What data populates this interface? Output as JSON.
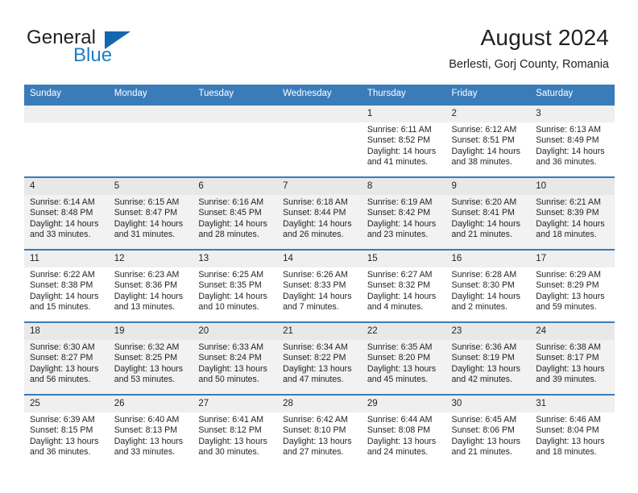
{
  "brand": {
    "name_part1": "General",
    "name_part2": "Blue",
    "accent_color": "#1567ad",
    "logo_icon": "triangle-flag-icon"
  },
  "header": {
    "title": "August 2024",
    "location": "Berlesti, Gorj County, Romania"
  },
  "theme": {
    "header_row_bg": "#3a7cba",
    "row_border": "#3a7cba",
    "daynum_bg": "#efefef",
    "shaded_row_bg": "#f2f2f2",
    "text_color": "#231f20"
  },
  "weekday_headers": [
    "Sunday",
    "Monday",
    "Tuesday",
    "Wednesday",
    "Thursday",
    "Friday",
    "Saturday"
  ],
  "weeks": [
    [
      {
        "day": "",
        "empty": true,
        "sunrise": "",
        "sunset": "",
        "daylight1": "",
        "daylight2": ""
      },
      {
        "day": "",
        "empty": true,
        "sunrise": "",
        "sunset": "",
        "daylight1": "",
        "daylight2": ""
      },
      {
        "day": "",
        "empty": true,
        "sunrise": "",
        "sunset": "",
        "daylight1": "",
        "daylight2": ""
      },
      {
        "day": "",
        "empty": true,
        "sunrise": "",
        "sunset": "",
        "daylight1": "",
        "daylight2": ""
      },
      {
        "day": "1",
        "empty": false,
        "sunrise": "Sunrise: 6:11 AM",
        "sunset": "Sunset: 8:52 PM",
        "daylight1": "Daylight: 14 hours",
        "daylight2": "and 41 minutes."
      },
      {
        "day": "2",
        "empty": false,
        "sunrise": "Sunrise: 6:12 AM",
        "sunset": "Sunset: 8:51 PM",
        "daylight1": "Daylight: 14 hours",
        "daylight2": "and 38 minutes."
      },
      {
        "day": "3",
        "empty": false,
        "sunrise": "Sunrise: 6:13 AM",
        "sunset": "Sunset: 8:49 PM",
        "daylight1": "Daylight: 14 hours",
        "daylight2": "and 36 minutes."
      }
    ],
    [
      {
        "day": "4",
        "empty": false,
        "sunrise": "Sunrise: 6:14 AM",
        "sunset": "Sunset: 8:48 PM",
        "daylight1": "Daylight: 14 hours",
        "daylight2": "and 33 minutes."
      },
      {
        "day": "5",
        "empty": false,
        "sunrise": "Sunrise: 6:15 AM",
        "sunset": "Sunset: 8:47 PM",
        "daylight1": "Daylight: 14 hours",
        "daylight2": "and 31 minutes."
      },
      {
        "day": "6",
        "empty": false,
        "sunrise": "Sunrise: 6:16 AM",
        "sunset": "Sunset: 8:45 PM",
        "daylight1": "Daylight: 14 hours",
        "daylight2": "and 28 minutes."
      },
      {
        "day": "7",
        "empty": false,
        "sunrise": "Sunrise: 6:18 AM",
        "sunset": "Sunset: 8:44 PM",
        "daylight1": "Daylight: 14 hours",
        "daylight2": "and 26 minutes."
      },
      {
        "day": "8",
        "empty": false,
        "sunrise": "Sunrise: 6:19 AM",
        "sunset": "Sunset: 8:42 PM",
        "daylight1": "Daylight: 14 hours",
        "daylight2": "and 23 minutes."
      },
      {
        "day": "9",
        "empty": false,
        "sunrise": "Sunrise: 6:20 AM",
        "sunset": "Sunset: 8:41 PM",
        "daylight1": "Daylight: 14 hours",
        "daylight2": "and 21 minutes."
      },
      {
        "day": "10",
        "empty": false,
        "sunrise": "Sunrise: 6:21 AM",
        "sunset": "Sunset: 8:39 PM",
        "daylight1": "Daylight: 14 hours",
        "daylight2": "and 18 minutes."
      }
    ],
    [
      {
        "day": "11",
        "empty": false,
        "sunrise": "Sunrise: 6:22 AM",
        "sunset": "Sunset: 8:38 PM",
        "daylight1": "Daylight: 14 hours",
        "daylight2": "and 15 minutes."
      },
      {
        "day": "12",
        "empty": false,
        "sunrise": "Sunrise: 6:23 AM",
        "sunset": "Sunset: 8:36 PM",
        "daylight1": "Daylight: 14 hours",
        "daylight2": "and 13 minutes."
      },
      {
        "day": "13",
        "empty": false,
        "sunrise": "Sunrise: 6:25 AM",
        "sunset": "Sunset: 8:35 PM",
        "daylight1": "Daylight: 14 hours",
        "daylight2": "and 10 minutes."
      },
      {
        "day": "14",
        "empty": false,
        "sunrise": "Sunrise: 6:26 AM",
        "sunset": "Sunset: 8:33 PM",
        "daylight1": "Daylight: 14 hours",
        "daylight2": "and 7 minutes."
      },
      {
        "day": "15",
        "empty": false,
        "sunrise": "Sunrise: 6:27 AM",
        "sunset": "Sunset: 8:32 PM",
        "daylight1": "Daylight: 14 hours",
        "daylight2": "and 4 minutes."
      },
      {
        "day": "16",
        "empty": false,
        "sunrise": "Sunrise: 6:28 AM",
        "sunset": "Sunset: 8:30 PM",
        "daylight1": "Daylight: 14 hours",
        "daylight2": "and 2 minutes."
      },
      {
        "day": "17",
        "empty": false,
        "sunrise": "Sunrise: 6:29 AM",
        "sunset": "Sunset: 8:29 PM",
        "daylight1": "Daylight: 13 hours",
        "daylight2": "and 59 minutes."
      }
    ],
    [
      {
        "day": "18",
        "empty": false,
        "sunrise": "Sunrise: 6:30 AM",
        "sunset": "Sunset: 8:27 PM",
        "daylight1": "Daylight: 13 hours",
        "daylight2": "and 56 minutes."
      },
      {
        "day": "19",
        "empty": false,
        "sunrise": "Sunrise: 6:32 AM",
        "sunset": "Sunset: 8:25 PM",
        "daylight1": "Daylight: 13 hours",
        "daylight2": "and 53 minutes."
      },
      {
        "day": "20",
        "empty": false,
        "sunrise": "Sunrise: 6:33 AM",
        "sunset": "Sunset: 8:24 PM",
        "daylight1": "Daylight: 13 hours",
        "daylight2": "and 50 minutes."
      },
      {
        "day": "21",
        "empty": false,
        "sunrise": "Sunrise: 6:34 AM",
        "sunset": "Sunset: 8:22 PM",
        "daylight1": "Daylight: 13 hours",
        "daylight2": "and 47 minutes."
      },
      {
        "day": "22",
        "empty": false,
        "sunrise": "Sunrise: 6:35 AM",
        "sunset": "Sunset: 8:20 PM",
        "daylight1": "Daylight: 13 hours",
        "daylight2": "and 45 minutes."
      },
      {
        "day": "23",
        "empty": false,
        "sunrise": "Sunrise: 6:36 AM",
        "sunset": "Sunset: 8:19 PM",
        "daylight1": "Daylight: 13 hours",
        "daylight2": "and 42 minutes."
      },
      {
        "day": "24",
        "empty": false,
        "sunrise": "Sunrise: 6:38 AM",
        "sunset": "Sunset: 8:17 PM",
        "daylight1": "Daylight: 13 hours",
        "daylight2": "and 39 minutes."
      }
    ],
    [
      {
        "day": "25",
        "empty": false,
        "sunrise": "Sunrise: 6:39 AM",
        "sunset": "Sunset: 8:15 PM",
        "daylight1": "Daylight: 13 hours",
        "daylight2": "and 36 minutes."
      },
      {
        "day": "26",
        "empty": false,
        "sunrise": "Sunrise: 6:40 AM",
        "sunset": "Sunset: 8:13 PM",
        "daylight1": "Daylight: 13 hours",
        "daylight2": "and 33 minutes."
      },
      {
        "day": "27",
        "empty": false,
        "sunrise": "Sunrise: 6:41 AM",
        "sunset": "Sunset: 8:12 PM",
        "daylight1": "Daylight: 13 hours",
        "daylight2": "and 30 minutes."
      },
      {
        "day": "28",
        "empty": false,
        "sunrise": "Sunrise: 6:42 AM",
        "sunset": "Sunset: 8:10 PM",
        "daylight1": "Daylight: 13 hours",
        "daylight2": "and 27 minutes."
      },
      {
        "day": "29",
        "empty": false,
        "sunrise": "Sunrise: 6:44 AM",
        "sunset": "Sunset: 8:08 PM",
        "daylight1": "Daylight: 13 hours",
        "daylight2": "and 24 minutes."
      },
      {
        "day": "30",
        "empty": false,
        "sunrise": "Sunrise: 6:45 AM",
        "sunset": "Sunset: 8:06 PM",
        "daylight1": "Daylight: 13 hours",
        "daylight2": "and 21 minutes."
      },
      {
        "day": "31",
        "empty": false,
        "sunrise": "Sunrise: 6:46 AM",
        "sunset": "Sunset: 8:04 PM",
        "daylight1": "Daylight: 13 hours",
        "daylight2": "and 18 minutes."
      }
    ]
  ]
}
